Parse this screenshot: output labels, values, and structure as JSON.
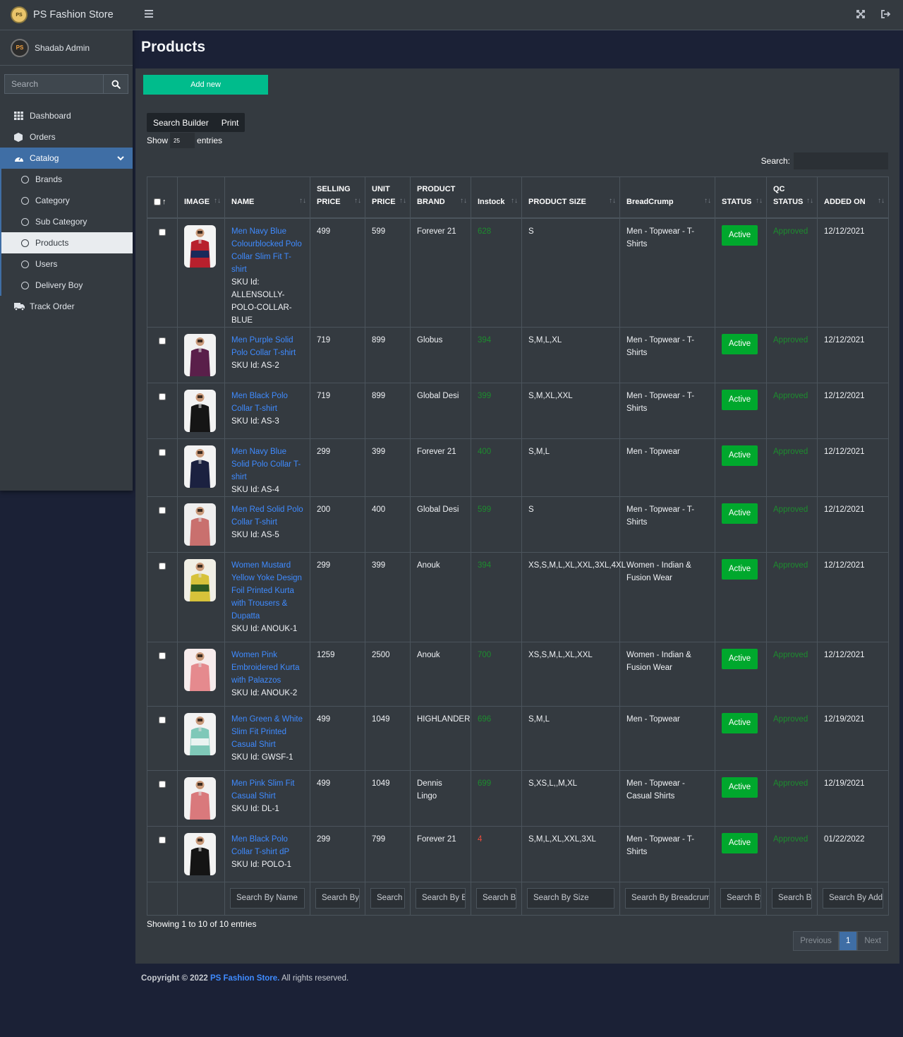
{
  "brand": {
    "logo_text": "PS",
    "name": "PS Fashion Store"
  },
  "user": {
    "avatar_text": "PS",
    "name": "Shadab Admin"
  },
  "sidebar": {
    "search_placeholder": "Search",
    "items": [
      {
        "label": "Dashboard",
        "icon": "grid-icon"
      },
      {
        "label": "Orders",
        "icon": "cube-icon"
      },
      {
        "label": "Catalog",
        "icon": "gauge-icon"
      }
    ],
    "catalog_children": [
      "Brands",
      "Category",
      "Sub Category",
      "Products",
      "Users",
      "Delivery Boy"
    ],
    "track_order": "Track Order"
  },
  "page": {
    "title": "Products"
  },
  "toolbar": {
    "add_new": "Add new",
    "search_builder": "Search Builder",
    "print": "Print"
  },
  "length": {
    "show": "Show",
    "value": "25",
    "entries": "entries"
  },
  "search": {
    "label": "Search:"
  },
  "table": {
    "headers": [
      {
        "line1": "",
        "line2": ""
      },
      {
        "line1": "",
        "line2": "IMAGE"
      },
      {
        "line1": "",
        "line2": "NAME"
      },
      {
        "line1": "SELLING",
        "line2": "PRICE"
      },
      {
        "line1": "UNIT",
        "line2": "PRICE"
      },
      {
        "line1": "PRODUCT",
        "line2": "BRAND"
      },
      {
        "line1": "",
        "line2": "Instock"
      },
      {
        "line1": "",
        "line2": "PRODUCT SIZE"
      },
      {
        "line1": "",
        "line2": "BreadCrump"
      },
      {
        "line1": "",
        "line2": "STATUS"
      },
      {
        "line1": "QC",
        "line2": "STATUS"
      },
      {
        "line1": "",
        "line2": "ADDED ON"
      }
    ],
    "rows": [
      {
        "name": "Men Navy Blue Colourblocked Polo Collar Slim Fit T-shirt",
        "sku": "SKU Id: ALLENSOLLY-POLO-COLLAR-BLUE",
        "selling": "499",
        "unit": "599",
        "brand": "Forever 21",
        "stock": "628",
        "stock_low": false,
        "size": "S",
        "crumb": "Men - Topwear - T-Shirts",
        "status": "Active",
        "qc": "Approved",
        "added": "12/12/2021",
        "shirt": "#b8202d",
        "shirt2": "#1a2a5a",
        "bg": "#f4f4f4"
      },
      {
        "name": "Men Purple Solid Polo Collar T-shirt",
        "sku": "SKU Id: AS-2",
        "selling": "719",
        "unit": "899",
        "brand": "Globus",
        "stock": "394",
        "stock_low": false,
        "size": "S,M,L,XL",
        "crumb": "Men - Topwear - T-Shirts",
        "status": "Active",
        "qc": "Approved",
        "added": "12/12/2021",
        "shirt": "#5a1f4a",
        "shirt2": "#5a1f4a",
        "bg": "#f2f2f2"
      },
      {
        "name": "Men Black Polo Collar T-shirt",
        "sku": "SKU Id: AS-3",
        "selling": "719",
        "unit": "899",
        "brand": "Global Desi",
        "stock": "399",
        "stock_low": false,
        "size": "S,M,XL,XXL",
        "crumb": "Men - Topwear - T-Shirts",
        "status": "Active",
        "qc": "Approved",
        "added": "12/12/2021",
        "shirt": "#151515",
        "shirt2": "#151515",
        "bg": "#f3f3f3"
      },
      {
        "name": "Men Navy Blue Solid Polo Collar T-shirt",
        "sku": "SKU Id: AS-4",
        "selling": "299",
        "unit": "399",
        "brand": "Forever 21",
        "stock": "400",
        "stock_low": false,
        "size": "S,M,L",
        "crumb": "Men - Topwear",
        "status": "Active",
        "qc": "Approved",
        "added": "12/12/2021",
        "shirt": "#1b2140",
        "shirt2": "#1b2140",
        "bg": "#f3f3f3"
      },
      {
        "name": "Men Red Solid Polo Collar T-shirt",
        "sku": "SKU Id: AS-5",
        "selling": "200",
        "unit": "400",
        "brand": "Global Desi",
        "stock": "599",
        "stock_low": false,
        "size": "S",
        "crumb": "Men - Topwear - T-Shirts",
        "status": "Active",
        "qc": "Approved",
        "added": "12/12/2021",
        "shirt": "#c9706e",
        "shirt2": "#c9706e",
        "bg": "#efefef"
      },
      {
        "name": "Women Mustard Yellow Yoke Design Foil Printed Kurta with Trousers & Dupatta",
        "sku": "SKU Id: ANOUK-1",
        "selling": "299",
        "unit": "399",
        "brand": "Anouk",
        "stock": "394",
        "stock_low": false,
        "size": "XS,S,M,L,XL,XXL,3XL,4XL",
        "crumb": "Women - Indian & Fusion Wear",
        "status": "Active",
        "qc": "Approved",
        "added": "12/12/2021",
        "shirt": "#d7c23a",
        "shirt2": "#2e5a22",
        "bg": "#f1efe6"
      },
      {
        "name": "Women Pink Embroidered Kurta with Palazzos",
        "sku": "SKU Id: ANOUK-2",
        "selling": "1259",
        "unit": "2500",
        "brand": "Anouk",
        "stock": "700",
        "stock_low": false,
        "size": "XS,S,M,L,XL,XXL",
        "crumb": "Women - Indian & Fusion Wear",
        "status": "Active",
        "qc": "Approved",
        "added": "12/12/2021",
        "shirt": "#e58a8e",
        "shirt2": "#e58a8e",
        "bg": "#f7ecec"
      },
      {
        "name": "Men Green & White Slim Fit Printed Casual Shirt",
        "sku": "SKU Id: GWSF-1",
        "selling": "499",
        "unit": "1049",
        "brand": "HIGHLANDER",
        "stock": "696",
        "stock_low": false,
        "size": "S,M,L",
        "crumb": "Men - Topwear",
        "status": "Active",
        "qc": "Approved",
        "added": "12/19/2021",
        "shirt": "#7fc8b8",
        "shirt2": "#eaf3f1",
        "bg": "#f3f3f3"
      },
      {
        "name": "Men Pink Slim Fit Casual Shirt",
        "sku": "SKU Id: DL-1",
        "selling": "499",
        "unit": "1049",
        "brand": "Dennis Lingo",
        "stock": "699",
        "stock_low": false,
        "size": "S,XS,L,,M,XL",
        "crumb": "Men - Topwear - Casual Shirts",
        "status": "Active",
        "qc": "Approved",
        "added": "12/19/2021",
        "shirt": "#d9797c",
        "shirt2": "#d9797c",
        "bg": "#f2f2f2"
      },
      {
        "name": "Men Black Polo Collar T-shirt dP",
        "sku": "SKU Id: POLO-1",
        "selling": "299",
        "unit": "799",
        "brand": "Forever 21",
        "stock": "4",
        "stock_low": true,
        "size": "S,M,L,XL,XXL,3XL",
        "crumb": "Men - Topwear - T-Shirts",
        "status": "Active",
        "qc": "Approved",
        "added": "01/22/2022",
        "shirt": "#141414",
        "shirt2": "#141414",
        "bg": "#f3f3f3"
      }
    ],
    "footer_placeholders": [
      "",
      "",
      "Search By Name",
      "Search By Selling Price",
      "Search By Unit Price",
      "Search By Brand",
      "Search By Stock",
      "Search By Size",
      "Search By Breadcrumb",
      "Search By Status",
      "Search By QC Status",
      "Search By Added On"
    ]
  },
  "info": "Showing 1 to 10 of 10 entries",
  "pagination": {
    "previous": "Previous",
    "current": "1",
    "next": "Next"
  },
  "footer": {
    "copyright": "Copyright © 2022",
    "store": "PS Fashion Store.",
    "rights": "All rights reserved."
  }
}
